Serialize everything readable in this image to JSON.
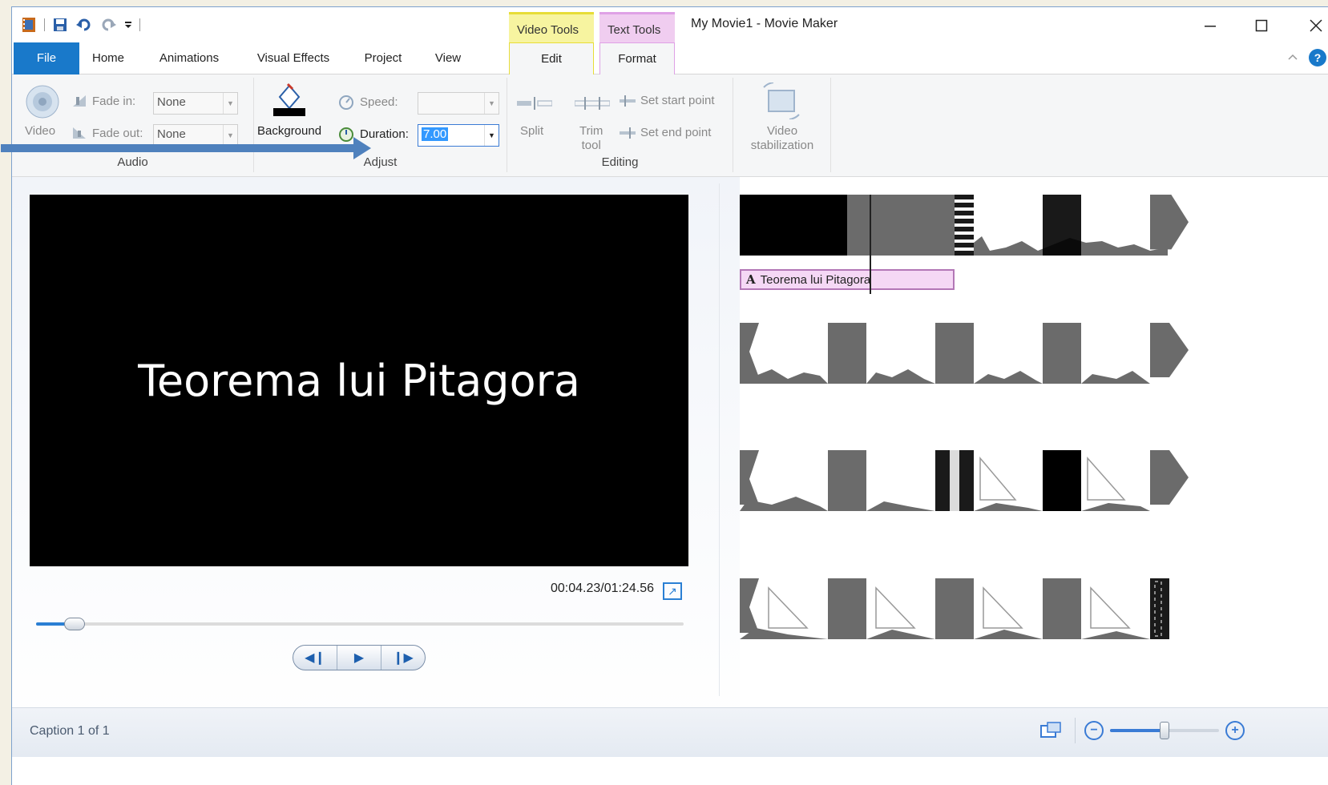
{
  "window": {
    "title": "My Movie1 - Movie Maker"
  },
  "context_tabs": {
    "video_tools": "Video Tools",
    "text_tools": "Text Tools"
  },
  "tabs": [
    "File",
    "Home",
    "Animations",
    "Visual Effects",
    "Project",
    "View",
    "Edit",
    "Format"
  ],
  "ribbon": {
    "audio": {
      "video_label": "Video",
      "fade_in_label": "Fade in:",
      "fade_in_value": "None",
      "fade_out_label": "Fade out:",
      "fade_out_value": "None",
      "group": "Audio"
    },
    "adjust": {
      "background_label": "Background",
      "speed_label": "Speed:",
      "speed_value": "",
      "duration_label": "Duration:",
      "duration_value": "7.00",
      "group": "Adjust"
    },
    "editing": {
      "split_label": "Split",
      "trim_label_1": "Trim",
      "trim_label_2": "tool",
      "set_start": "Set start point",
      "set_end": "Set end point",
      "group": "Editing"
    },
    "stabilization": {
      "label_1": "Video",
      "label_2": "stabilization"
    }
  },
  "preview": {
    "caption_text": "Teorema lui Pitagora",
    "time": "00:04.23/01:24.56",
    "progress": 0.06
  },
  "storyboard": {
    "caption_clip": "Teorema lui Pitagora"
  },
  "status": {
    "caption_count": "Caption 1 of 1",
    "zoom_level": 0.5
  },
  "icons": [
    "app-icon",
    "save-icon",
    "undo-icon",
    "redo-icon",
    "qat-dropdown-icon",
    "minimize-icon",
    "maximize-icon",
    "close-icon",
    "help-icon",
    "collapse-ribbon-icon",
    "speaker-icon",
    "fade-in-icon",
    "fade-out-icon",
    "paint-bucket-icon",
    "speed-icon",
    "duration-icon",
    "split-icon",
    "trim-icon",
    "set-start-icon",
    "set-end-icon",
    "stabilization-icon",
    "fullscreen-icon",
    "prev-frame-icon",
    "play-icon",
    "next-frame-icon",
    "storyboard-icon",
    "zoom-out-icon",
    "zoom-in-icon"
  ],
  "colors": {
    "file_tab": "#1979ca",
    "video_tools": "#f7f4a0",
    "text_tools": "#f0cdf0",
    "accent": "#2a7fd4",
    "annotation_arrow": "#4f81bd"
  }
}
